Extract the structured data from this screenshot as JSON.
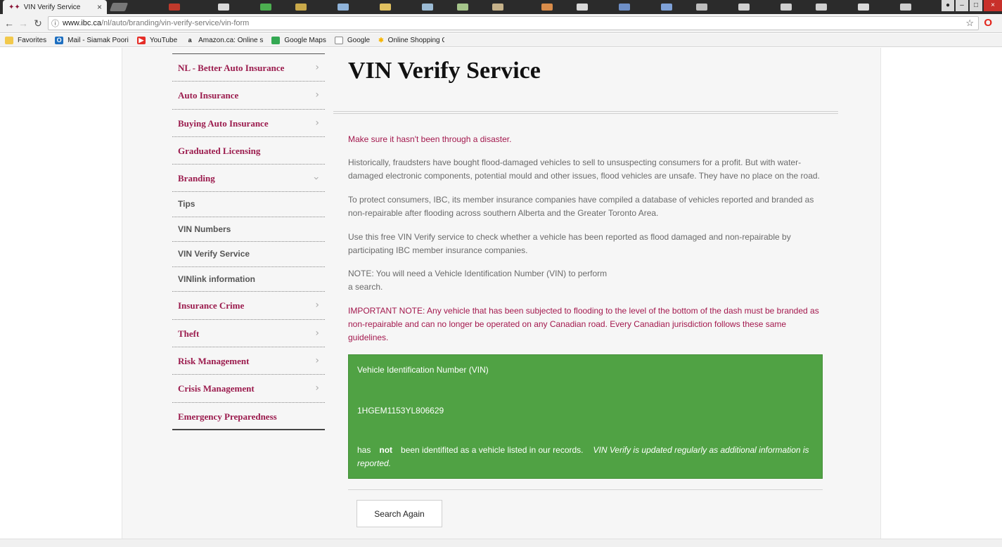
{
  "browser": {
    "tab_title": "VIN Verify Service",
    "url_host": "www.ibc.ca",
    "url_path": "/nl/auto/branding/vin-verify-service/vin-form",
    "bookmarks": [
      {
        "label": "Favorites",
        "icon": "folder-icon",
        "color": "#f2c94c"
      },
      {
        "label": "Mail - Siamak Poori",
        "icon": "outlook-icon",
        "color": "#1e6fc0"
      },
      {
        "label": "YouTube",
        "icon": "youtube-icon",
        "color": "#e52d27"
      },
      {
        "label": "Amazon.ca: Online s",
        "icon": "amazon-icon",
        "color": "#222222"
      },
      {
        "label": "Google Maps",
        "icon": "maps-icon",
        "color": "#34a853"
      },
      {
        "label": "Google",
        "icon": "page-icon",
        "color": "#888888"
      },
      {
        "label": "Online Shopping Ca",
        "icon": "walmart-icon",
        "color": "#f7b500"
      }
    ]
  },
  "sidebar": {
    "items": [
      {
        "label": "NL - Better Auto Insurance",
        "chevron": "right"
      },
      {
        "label": "Auto Insurance",
        "chevron": "right"
      },
      {
        "label": "Buying Auto Insurance",
        "chevron": "right"
      },
      {
        "label": "Graduated Licensing",
        "chevron": ""
      },
      {
        "label": "Branding",
        "chevron": "down"
      }
    ],
    "subitems": [
      "Tips",
      "VIN Numbers",
      "VIN Verify Service",
      "VINlink information"
    ],
    "items_after": [
      {
        "label": "Insurance Crime",
        "chevron": "right"
      },
      {
        "label": "Theft",
        "chevron": "right"
      },
      {
        "label": "Risk Management",
        "chevron": "right"
      },
      {
        "label": "Crisis Management",
        "chevron": "right"
      },
      {
        "label": "Emergency Preparedness",
        "chevron": ""
      }
    ]
  },
  "content": {
    "title": "VIN Verify Service",
    "intro": "Make sure it hasn't been through a disaster.",
    "p1": "Historically, fraudsters have bought flood-damaged vehicles to sell to unsuspecting consumers for a profit. But with water-damaged electronic components, potential mould and other issues, flood vehicles are unsafe. They have no place on the road.",
    "p2": "To protect consumers, IBC, its member insurance companies have compiled a database of vehicles reported and branded as non-repairable after flooding across southern Alberta and the Greater Toronto Area.",
    "p3": "Use this free VIN Verify service to check whether a vehicle has been reported as flood damaged and non-repairable by participating IBC member insurance companies.",
    "note_line1": "NOTE: You will need a Vehicle Identification Number (VIN) to perform",
    "note_line2": "a search.",
    "important": "IMPORTANT NOTE: Any vehicle that has been subjected to flooding to the level of the bottom of the dash must be branded as non-repairable and can no longer be operated on any Canadian road. Every Canadian jurisdiction follows these same guidelines."
  },
  "result": {
    "label": "Vehicle Identification Number (VIN)",
    "vin": "1HGEM1153YL806629",
    "msg_has": "has",
    "msg_not": "not",
    "msg_rest": "been identifited as a vehicle listed in our records.",
    "msg_italic": "VIN Verify is updated regularly as additional information is reported.",
    "bg_color": "#50a244"
  },
  "button": {
    "search_again": "Search Again"
  }
}
